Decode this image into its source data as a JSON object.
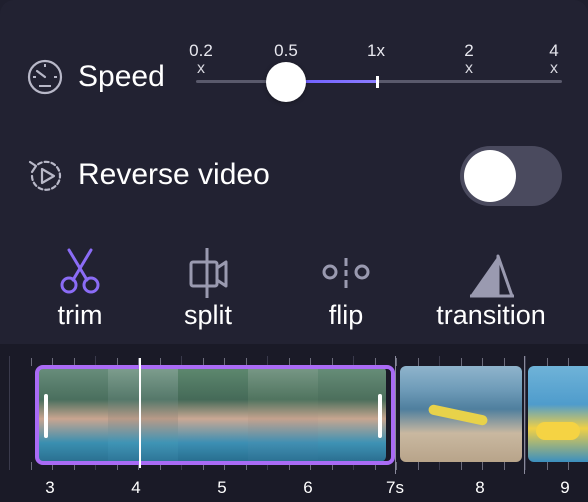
{
  "speed": {
    "label": "Speed",
    "ticks": [
      {
        "value": "0.2",
        "mark": "x"
      },
      {
        "value": "0.5",
        "mark": ""
      },
      {
        "value": "1x",
        "mark": ""
      },
      {
        "value": "2",
        "mark": "x"
      },
      {
        "value": "4",
        "mark": "x"
      }
    ],
    "selected": "0.5"
  },
  "reverse": {
    "label": "Reverse video",
    "enabled": false
  },
  "tools": [
    {
      "label": "trim",
      "icon": "scissors-icon",
      "color": "#8b6cf6"
    },
    {
      "label": "split",
      "icon": "split-icon",
      "color": "#9a9ab0"
    },
    {
      "label": "flip",
      "icon": "flip-icon",
      "color": "#9a9ab0"
    },
    {
      "label": "transition",
      "icon": "transition-icon",
      "color": "#9a9ab0"
    }
  ],
  "timeline": {
    "ruler_labels": [
      "3",
      "4",
      "5",
      "6",
      "7s",
      "8",
      "9"
    ],
    "selection_color": "#a96bf5"
  }
}
